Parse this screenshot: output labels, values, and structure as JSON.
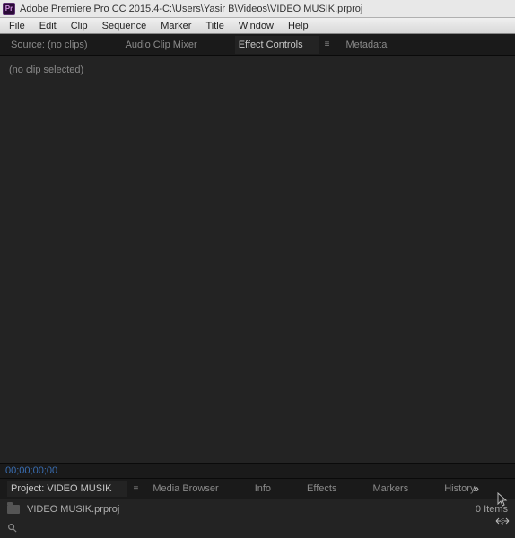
{
  "titlebar": {
    "app_name": "Adobe Premiere Pro CC 2015.4",
    "separator": " - ",
    "file_path": "C:\\Users\\Yasir B\\Videos\\VIDEO MUSIK.prproj"
  },
  "menu": {
    "file": "File",
    "edit": "Edit",
    "clip": "Clip",
    "sequence": "Sequence",
    "marker": "Marker",
    "title": "Title",
    "window": "Window",
    "help": "Help"
  },
  "upper_tabs": {
    "source": "Source: (no clips)",
    "audio_mixer": "Audio Clip Mixer",
    "effect_controls": "Effect Controls",
    "metadata": "Metadata"
  },
  "effect_panel": {
    "no_clip": "(no clip selected)",
    "timecode": "00;00;00;00"
  },
  "lower_tabs": {
    "project": "Project: VIDEO MUSIK",
    "media_browser": "Media Browser",
    "info": "Info",
    "effects": "Effects",
    "markers": "Markers",
    "history": "History"
  },
  "project_panel": {
    "filename": "VIDEO MUSIK.prproj",
    "item_count": "0 Items"
  },
  "icons": {
    "app_badge": "Pr",
    "overflow": "»",
    "tab_menu": "≡"
  }
}
